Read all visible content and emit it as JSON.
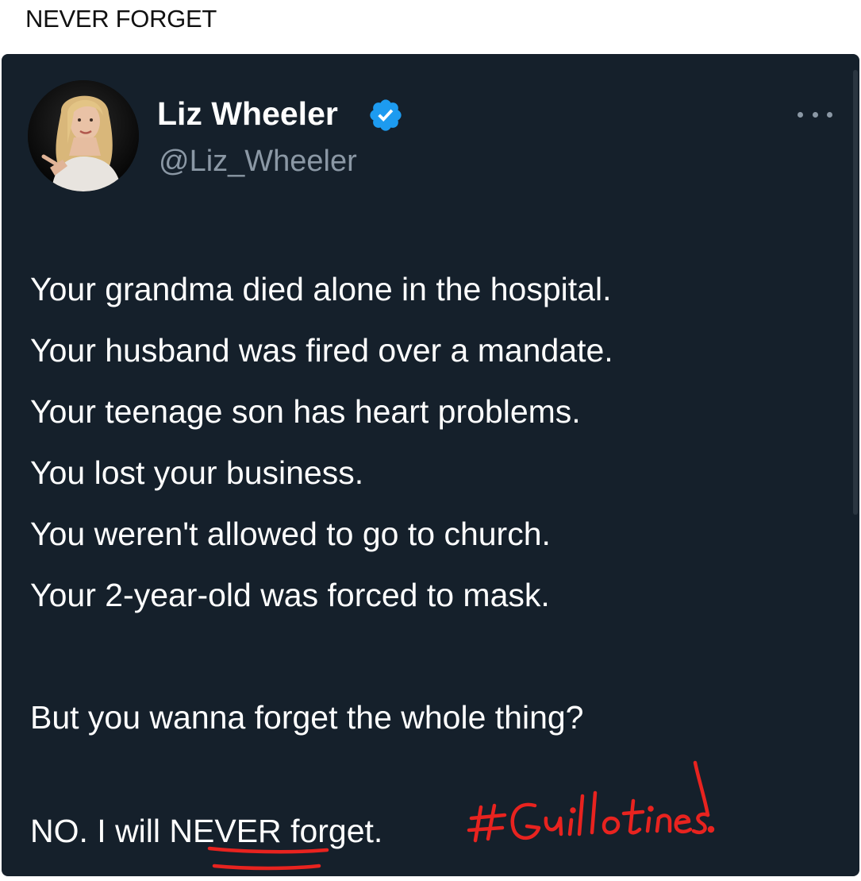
{
  "page": {
    "title": "NEVER FORGET"
  },
  "tweet": {
    "author_name": "Liz Wheeler",
    "author_handle": "@Liz_Wheeler",
    "lines": [
      "Your grandma died alone in the hospital.",
      "Your husband was fired over a mandate.",
      "Your teenage son has heart problems.",
      "You lost your business.",
      "You weren't allowed to go to church.",
      "Your 2-year-old was forced to mask.",
      "",
      "But you wanna forget the whole thing?",
      ""
    ],
    "final_prefix": "NO. I will ",
    "final_emphasis": "NEVER",
    "final_suffix": " forget."
  },
  "annotation": {
    "handwritten_text": "#Guillotines!",
    "ink_color": "#e8231f"
  },
  "colors": {
    "card_background": "#15202b",
    "verified_blue": "#1d9bf0",
    "secondary_text": "#8b98a5"
  },
  "icons": {
    "verified": "verified-badge-icon",
    "more": "more-options-icon"
  }
}
